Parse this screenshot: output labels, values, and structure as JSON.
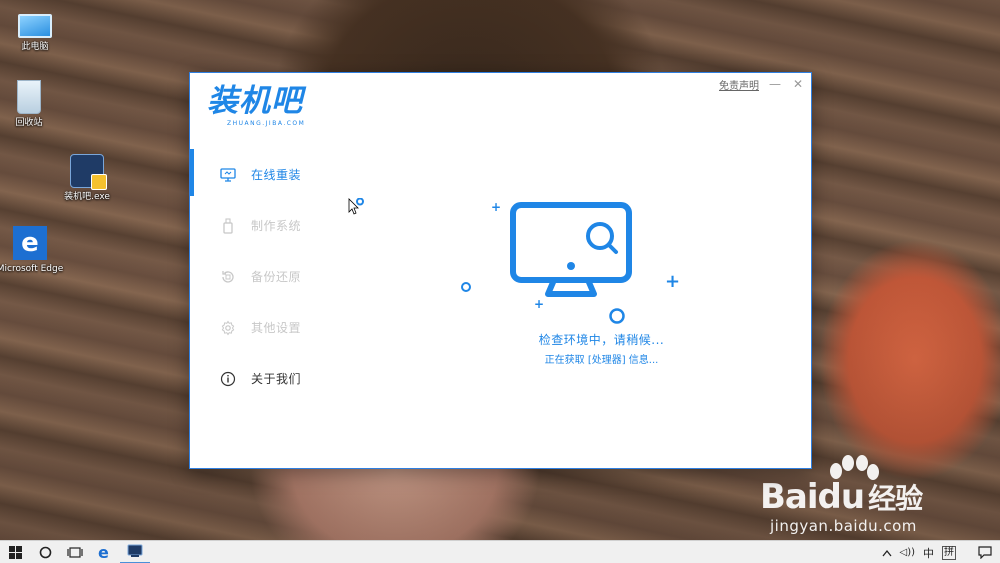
{
  "desktop": {
    "icons": [
      {
        "label": "此电脑",
        "icon": "computer-icon"
      },
      {
        "label": "回收站",
        "icon": "recycle-bin-icon"
      },
      {
        "label": "装机吧.exe",
        "icon": "zhuangjiba-app-icon"
      },
      {
        "label": "Microsoft Edge",
        "icon": "edge-icon"
      }
    ]
  },
  "window": {
    "logo_text": "装机吧",
    "logo_subtext": "ZHUANG.JIBA.COM",
    "disclaimer": "免责声明",
    "minimize": "—",
    "close": "✕",
    "nav": [
      {
        "label": "在线重装",
        "icon": "monitor-icon",
        "active": true
      },
      {
        "label": "制作系统",
        "icon": "usb-drive-icon",
        "active": false
      },
      {
        "label": "备份还原",
        "icon": "backup-restore-icon",
        "active": false
      },
      {
        "label": "其他设置",
        "icon": "gear-icon",
        "active": false
      },
      {
        "label": "关于我们",
        "icon": "info-icon",
        "active": false
      }
    ],
    "status_main": "检查环境中，请稍候...",
    "status_sub": "正在获取 [处理器] 信息..."
  },
  "watermark": {
    "brand_bai": "Bai",
    "brand_du": "du",
    "brand_jingyan": "经验",
    "url": "jingyan.baidu.com"
  },
  "taskbar": {
    "tray": {
      "volume": "◁))",
      "language": "中",
      "ime": "拼"
    }
  },
  "colors": {
    "accent": "#1f86e6",
    "inactive_nav": "#c8c8c8",
    "taskbar": "#f0f0f0"
  }
}
